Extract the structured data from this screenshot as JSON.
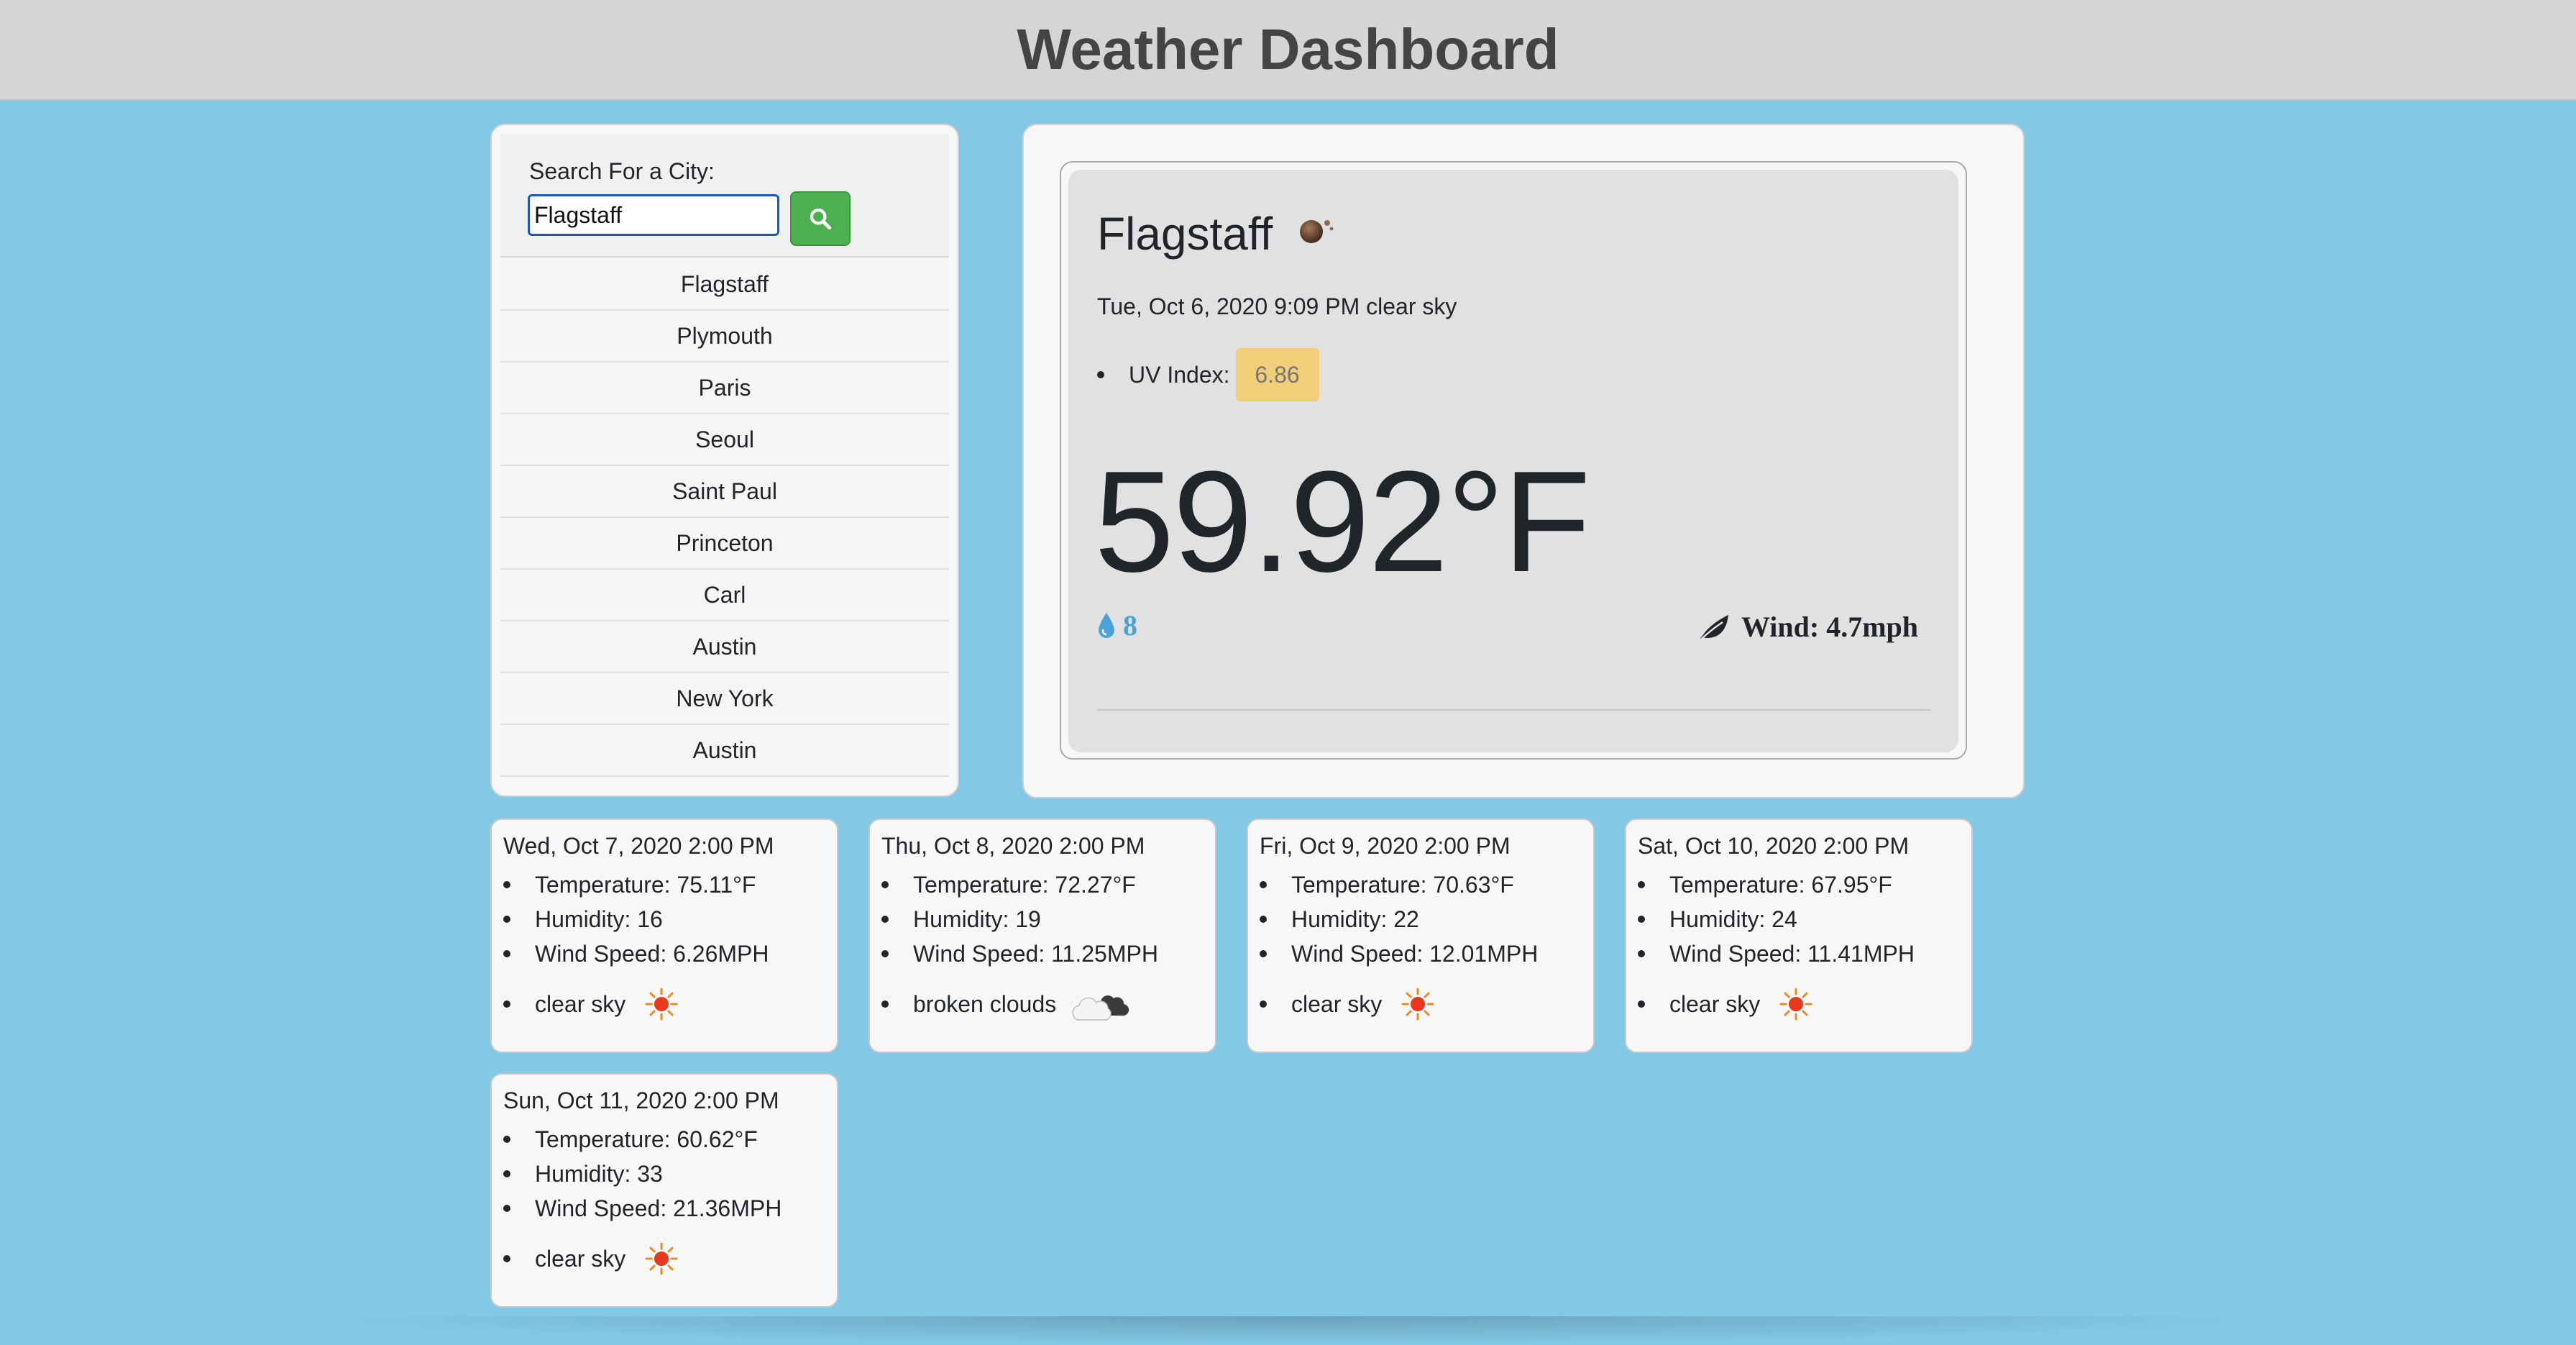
{
  "header": {
    "title": "Weather Dashboard"
  },
  "search": {
    "label": "Search For a City:",
    "value": "Flagstaff",
    "button_icon": "search-icon"
  },
  "history": [
    "Flagstaff",
    "Plymouth",
    "Paris",
    "Seoul",
    "Saint Paul",
    "Princeton",
    "Carl",
    "Austin",
    "New York",
    "Austin"
  ],
  "current": {
    "city": "Flagstaff",
    "icon": "clear-sky-night-icon",
    "date_desc": "Tue, Oct 6, 2020 9:09 PM clear sky",
    "uv_label": "UV Index:",
    "uv_value": "6.86",
    "uv_color": "#f1cf78",
    "temperature": "59.92°F",
    "humidity": "8",
    "wind": "Wind: 4.7mph"
  },
  "forecast": [
    {
      "date": "Wed, Oct 7, 2020 2:00 PM",
      "temperature": "Temperature: 75.11°F",
      "humidity": "Humidity: 16",
      "wind": "Wind Speed: 6.26MPH",
      "description": "clear sky",
      "icon": "sun-icon"
    },
    {
      "date": "Thu, Oct 8, 2020 2:00 PM",
      "temperature": "Temperature: 72.27°F",
      "humidity": "Humidity: 19",
      "wind": "Wind Speed: 11.25MPH",
      "description": "broken clouds",
      "icon": "cloud-icon"
    },
    {
      "date": "Fri, Oct 9, 2020 2:00 PM",
      "temperature": "Temperature: 70.63°F",
      "humidity": "Humidity: 22",
      "wind": "Wind Speed: 12.01MPH",
      "description": "clear sky",
      "icon": "sun-icon"
    },
    {
      "date": "Sat, Oct 10, 2020 2:00 PM",
      "temperature": "Temperature: 67.95°F",
      "humidity": "Humidity: 24",
      "wind": "Wind Speed: 11.41MPH",
      "description": "clear sky",
      "icon": "sun-icon"
    },
    {
      "date": "Sun, Oct 11, 2020 2:00 PM",
      "temperature": "Temperature: 60.62°F",
      "humidity": "Humidity: 33",
      "wind": "Wind Speed: 21.36MPH",
      "description": "clear sky",
      "icon": "sun-icon"
    }
  ],
  "colors": {
    "background": "#83c9e6",
    "accent_button": "#4caf50",
    "humidity_text": "#4aa3d6"
  }
}
